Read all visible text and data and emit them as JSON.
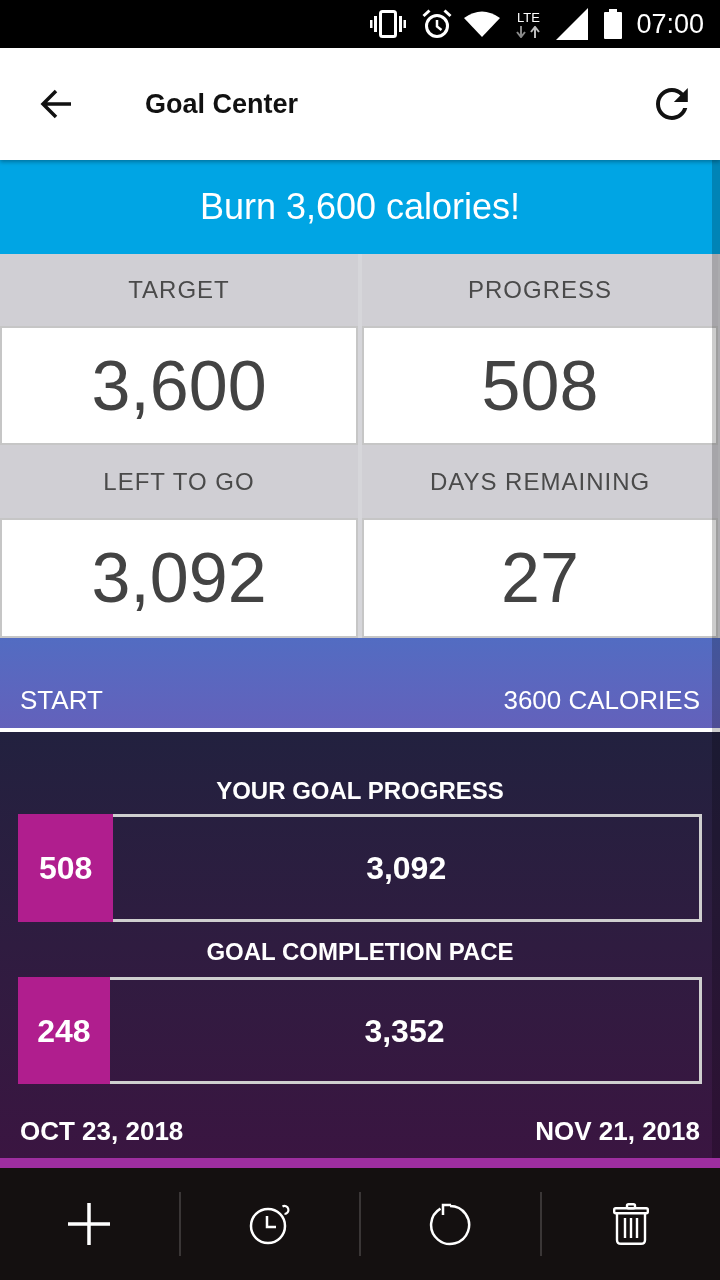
{
  "status_bar": {
    "network": "LTE",
    "time": "07:00"
  },
  "app_bar": {
    "title": "Goal Center"
  },
  "banner": {
    "text": "Burn 3,600 calories!"
  },
  "stats": [
    {
      "label": "TARGET",
      "value": "3,600"
    },
    {
      "label": "PROGRESS",
      "value": "508"
    },
    {
      "label": "LEFT TO GO",
      "value": "3,092"
    },
    {
      "label": "DAYS REMAINING",
      "value": "27"
    }
  ],
  "range": {
    "start": "START",
    "end": "3600 CALORIES"
  },
  "progress_bars": [
    {
      "title": "YOUR GOAL PROGRESS",
      "done": "508",
      "remaining": "3,092",
      "level": 0.14
    },
    {
      "title": "GOAL COMPLETION PACE",
      "done": "248",
      "remaining": "3,352",
      "level": 0.135
    }
  ],
  "dates": {
    "start": "OCT 23, 2018",
    "end": "NOV 21, 2018"
  }
}
